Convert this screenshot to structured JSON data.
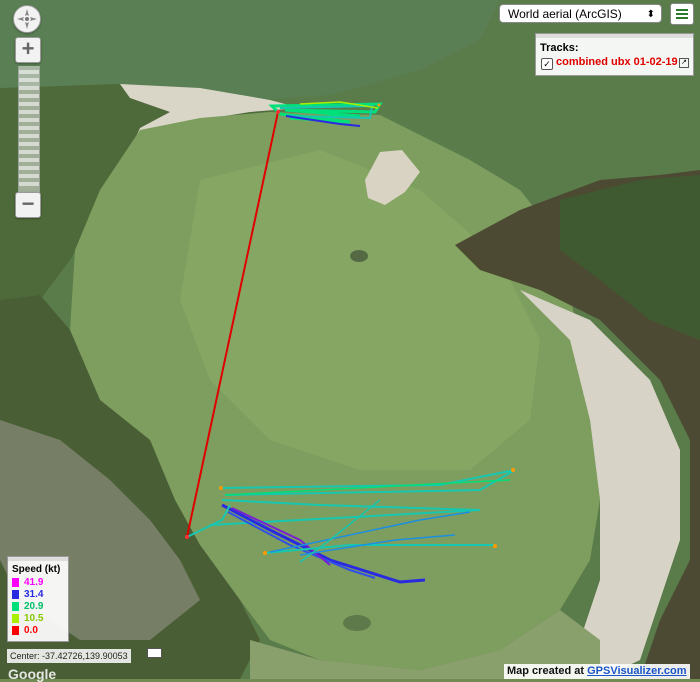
{
  "map_type": {
    "selected": "World aerial (ArcGIS)"
  },
  "tracks_panel": {
    "title": "Tracks:",
    "checked": true,
    "track_name": "combined ubx 01-02-19"
  },
  "speed_legend": {
    "title": "Speed (kt)",
    "levels": [
      {
        "label": "41.9",
        "color": "#ff00ff"
      },
      {
        "label": "31.4",
        "color": "#2a2ae0"
      },
      {
        "label": "20.9",
        "color": "#00e07a"
      },
      {
        "label": "10.5",
        "color": "#a8f000"
      },
      {
        "label": "0.0",
        "color": "#ff0000"
      }
    ]
  },
  "center_readout": "Center: -37.42726,139.90053",
  "credit": {
    "prefix": "Map created at",
    "link": "GPSVisualizer.com"
  },
  "google_mark": "Google",
  "colors": {
    "transfer_line": "#e00000",
    "ui_accent": "#2b7a2b"
  }
}
